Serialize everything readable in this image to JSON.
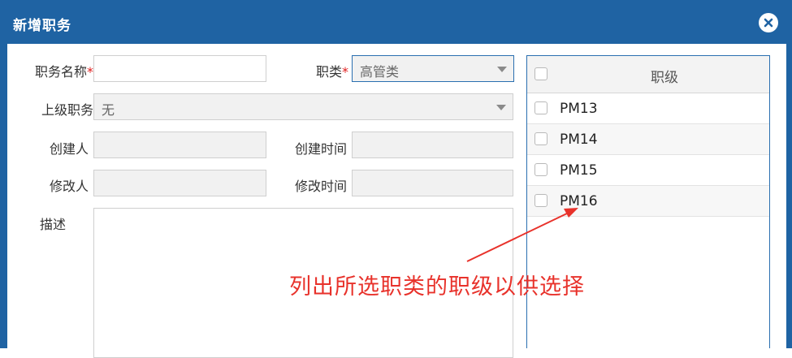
{
  "dialog": {
    "title": "新增职务",
    "close_icon": "close-circle-icon"
  },
  "form": {
    "position_name": {
      "label": "职务名称",
      "required_mark": "*",
      "value": ""
    },
    "category": {
      "label": "职类",
      "required_mark": "*",
      "value": "高管类"
    },
    "parent_position": {
      "label": "上级职务",
      "value": "无"
    },
    "creator": {
      "label": "创建人",
      "value": ""
    },
    "created_time": {
      "label": "创建时间",
      "value": ""
    },
    "modifier": {
      "label": "修改人",
      "value": ""
    },
    "modified_time": {
      "label": "修改时间",
      "value": ""
    },
    "description": {
      "label": "描述",
      "value": ""
    }
  },
  "grade_list": {
    "header": "职级",
    "rows": [
      "PM13",
      "PM14",
      "PM15",
      "PM16"
    ]
  },
  "annotation": {
    "text": "列出所选职类的职级以供选择",
    "color": "#e8322b"
  },
  "colors": {
    "title_bar": "#1f63a3",
    "accent_border": "#2a6fb0"
  }
}
